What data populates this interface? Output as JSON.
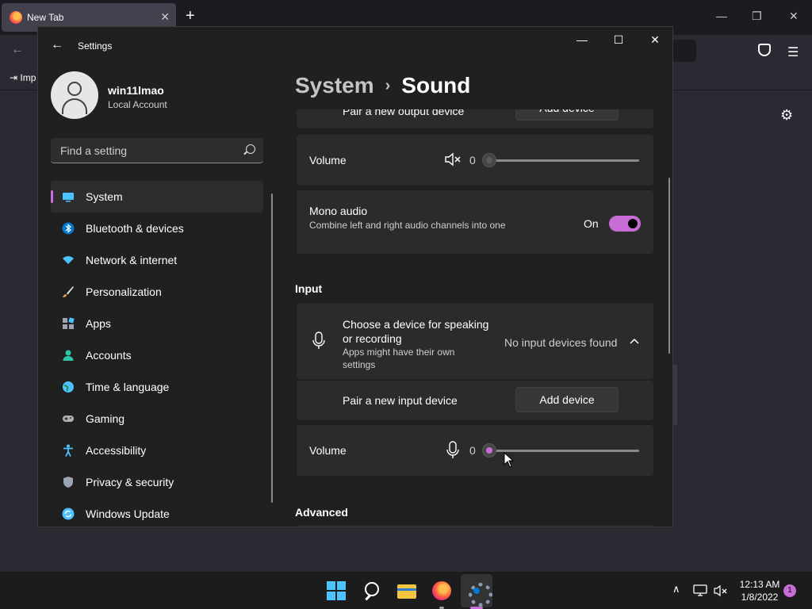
{
  "browser": {
    "tab_title": "New Tab",
    "tab_close": "✕",
    "new_tab": "+",
    "bookmark_import": "⇥ Imp",
    "back": "←",
    "menu": "☰",
    "settings_gear": "⚙",
    "min": "—",
    "restore": "❐",
    "close": "✕"
  },
  "window": {
    "title": "Settings",
    "back": "←",
    "min": "—",
    "max": "☐",
    "close": "✕"
  },
  "profile": {
    "name": "win11lmao",
    "account_type": "Local Account"
  },
  "search": {
    "placeholder": "Find a setting"
  },
  "nav": {
    "items": [
      {
        "label": "System",
        "icon": "system-icon",
        "color": "#4cc2ff"
      },
      {
        "label": "Bluetooth & devices",
        "icon": "bluetooth-icon",
        "color": "#0078d4"
      },
      {
        "label": "Network & internet",
        "icon": "wifi-icon",
        "color": "#4cc2ff"
      },
      {
        "label": "Personalization",
        "icon": "brush-icon",
        "color": "#e6a35c"
      },
      {
        "label": "Apps",
        "icon": "apps-icon",
        "color": "#9aa5b1"
      },
      {
        "label": "Accounts",
        "icon": "accounts-icon",
        "color": "#2ec4a6"
      },
      {
        "label": "Time & language",
        "icon": "globe-icon",
        "color": "#4cc2ff"
      },
      {
        "label": "Gaming",
        "icon": "controller-icon",
        "color": "#b0b0b0"
      },
      {
        "label": "Accessibility",
        "icon": "accessibility-icon",
        "color": "#4cc2ff"
      },
      {
        "label": "Privacy & security",
        "icon": "shield-icon",
        "color": "#9aa5b1"
      },
      {
        "label": "Windows Update",
        "icon": "update-icon",
        "color": "#4cc2ff"
      }
    ]
  },
  "breadcrumb": {
    "parent": "System",
    "separator": "›",
    "current": "Sound"
  },
  "output": {
    "pair_label": "Pair a new output device",
    "pair_button": "Add device",
    "volume_label": "Volume",
    "volume_value": "0",
    "volume_level": 0,
    "mono_label": "Mono audio",
    "mono_desc": "Combine left and right audio channels into one",
    "mono_state": "On"
  },
  "input": {
    "section_title": "Input",
    "choose_label": "Choose a device for speaking or recording",
    "choose_desc": "Apps might have their own settings",
    "choose_value": "No input devices found",
    "pair_label": "Pair a new input device",
    "pair_button": "Add device",
    "volume_label": "Volume",
    "volume_value": "0",
    "volume_level": 0
  },
  "advanced": {
    "section_title": "Advanced"
  },
  "taskbar": {
    "time": "12:13 AM",
    "date": "1/8/2022",
    "notifications": "1",
    "chevron": "∧",
    "accent": "#c86dd7"
  }
}
